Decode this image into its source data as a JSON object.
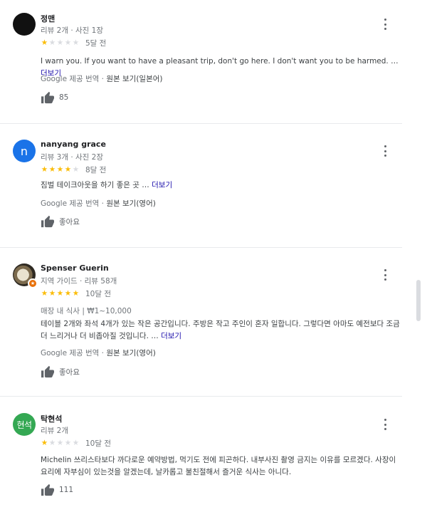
{
  "colors": {
    "star_on": "#fbbc04",
    "star_off": "#dadce0",
    "link": "#1a0dab",
    "avatar_black": "#111111",
    "avatar_blue": "#1a73e8",
    "avatar_green": "#34a853"
  },
  "reviews": [
    {
      "name": "정맨",
      "meta": "리뷰 2개 · 사진 1장",
      "rating": 1,
      "max_rating": 5,
      "time": "5달 전",
      "text": "I warn you. If you want to have a pleasant trip, don't go here. I don't want you to be harmed. …",
      "more": "더보기",
      "translate_prefix": "Google 제공 번역 · ",
      "translate_orig": "원본 보기(일본어)",
      "like": "85",
      "avatar_icon": "black-circle-avatar"
    },
    {
      "name": "nanyang grace",
      "meta": "리뷰 3개 · 사진 2장",
      "avatar_letter": "n",
      "rating": 4,
      "max_rating": 5,
      "time": "8달 전",
      "text": "짐벌 테이크아웃을 하기 좋은 곳 …",
      "more": "더보기",
      "translate_prefix": "Google 제공 번역 · ",
      "translate_orig": "원본 보기(영어)",
      "like": "좋아요"
    },
    {
      "name": "Spenser Guerin",
      "meta": "지역 가이드 · 리뷰 58개",
      "rating": 5,
      "max_rating": 5,
      "time": "10달 전",
      "price": "매장 내 식사 | ₩1~10,000",
      "text": "테이블 2개와 좌석 4개가 있는 작은 공간입니다. 주방은 작고 주인이 혼자 일합니다. 그렇다면 아마도 예전보다 조금 더 느리거나 더 비좁아질 것입니다. …",
      "more": "더보기",
      "translate_prefix": "Google 제공 번역 · ",
      "translate_orig": "원본 보기(영어)",
      "like": "좋아요",
      "avatar_icon": "profile-photo-with-local-guide-badge"
    },
    {
      "name": "탁현석",
      "meta": "리뷰 2개",
      "avatar_letter": "현석",
      "rating": 1,
      "max_rating": 5,
      "time": "10달 전",
      "text": "Michelin 쓰리스타보다 까다로운 예약방법, 먹기도 전에 피곤하다. 내부사진 촬영 금지는 이유를 모르겠다. 사장이 요리에 자부심이 있는것을 알겠는데, 날카롭고 불친절해서 즐거운 식사는 아니다.",
      "like": "111"
    }
  ]
}
